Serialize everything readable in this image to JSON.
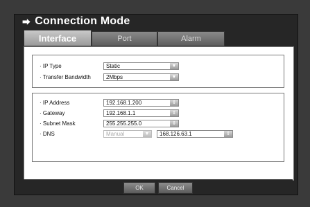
{
  "title": "Connection Mode",
  "title_icon": "enter-arrow-icon",
  "tabs": [
    {
      "label": "Interface",
      "active": true
    },
    {
      "label": "Port",
      "active": false
    },
    {
      "label": "Alarm",
      "active": false
    }
  ],
  "interface_group": {
    "ip_type": {
      "label": "· IP Type",
      "value": "Static"
    },
    "transfer_bandwidth": {
      "label": "· Transfer Bandwidth",
      "value": "2Mbps"
    }
  },
  "network_group": {
    "ip_address": {
      "label": "· IP Address",
      "value": "192.168.1.200"
    },
    "gateway": {
      "label": "· Gateway",
      "value": "192.168.1.1"
    },
    "subnet_mask": {
      "label": "· Subnet Mask",
      "value": "255.255.255.0"
    },
    "dns": {
      "label": "· DNS",
      "mode": "Manual",
      "value": "168.126.63.1"
    }
  },
  "buttons": {
    "ok": "OK",
    "cancel": "Cancel"
  }
}
